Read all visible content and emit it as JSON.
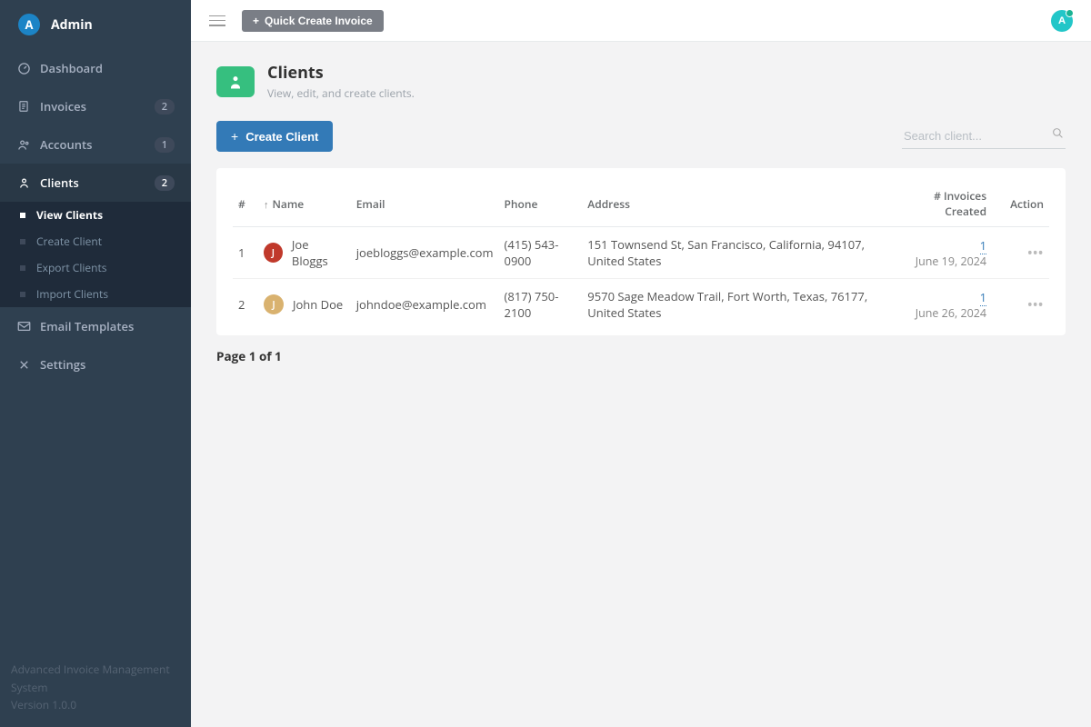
{
  "sidebar": {
    "avatar_initial": "A",
    "user_name": "Admin",
    "items": [
      {
        "label": "Dashboard",
        "badge": null
      },
      {
        "label": "Invoices",
        "badge": "2"
      },
      {
        "label": "Accounts",
        "badge": "1"
      },
      {
        "label": "Clients",
        "badge": "2"
      },
      {
        "label": "Email Templates",
        "badge": null
      },
      {
        "label": "Settings",
        "badge": null
      }
    ],
    "subnav": [
      {
        "label": "View Clients"
      },
      {
        "label": "Create Client"
      },
      {
        "label": "Export Clients"
      },
      {
        "label": "Import Clients"
      }
    ],
    "footer_line1": "Advanced Invoice Management System",
    "footer_line2": "Version 1.0.0"
  },
  "topbar": {
    "quick_create_label": "Quick Create Invoice",
    "avatar_initial": "A"
  },
  "page": {
    "title": "Clients",
    "subtitle": "View, edit, and create clients.",
    "create_button": "Create Client",
    "search_placeholder": "Search client..."
  },
  "table": {
    "headers": {
      "num": "#",
      "name": "Name",
      "email": "Email",
      "phone": "Phone",
      "address": "Address",
      "invoices": "# Invoices Created",
      "action": "Action"
    },
    "rows": [
      {
        "num": "1",
        "avatar_initial": "J",
        "avatar_color": "#c0392b",
        "name": "Joe Bloggs",
        "email": "joebloggs@example.com",
        "phone": "(415) 543-0900",
        "address": "151 Townsend St, San Francisco, California, 94107, United States",
        "invoices": "1",
        "date": "June 19, 2024"
      },
      {
        "num": "2",
        "avatar_initial": "J",
        "avatar_color": "#d9b26f",
        "name": "John Doe",
        "email": "johndoe@example.com",
        "phone": "(817) 750-2100",
        "address": "9570 Sage Meadow Trail, Fort Worth, Texas, 76177, United States",
        "invoices": "1",
        "date": "June 26, 2024"
      }
    ]
  },
  "pagination": "Page 1 of 1"
}
